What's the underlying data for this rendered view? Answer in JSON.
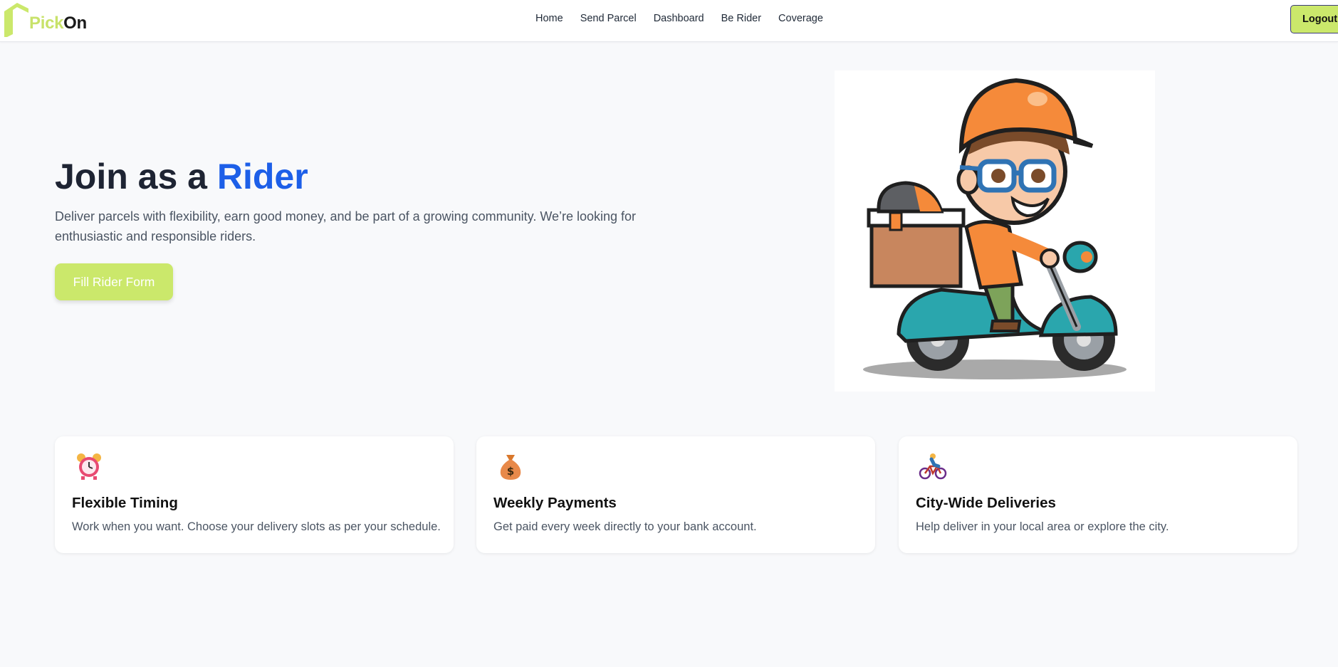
{
  "brand": {
    "part1": "Pick",
    "part2": "On"
  },
  "nav": {
    "links": [
      "Home",
      "Send Parcel",
      "Dashboard",
      "Be Rider",
      "Coverage"
    ],
    "logout_label": "Logout"
  },
  "hero": {
    "title_prefix": "Join as a ",
    "title_accent": "Rider",
    "description": "Deliver parcels with flexibility, earn good money, and be part of a growing community. We’re looking for enthusiastic and responsible riders.",
    "cta_label": "Fill Rider Form",
    "image": "delivery-rider-on-scooter-illustration"
  },
  "features": [
    {
      "icon": "alarm-clock-icon",
      "title": "Flexible Timing",
      "description": "Work when you want. Choose your delivery slots as per your schedule."
    },
    {
      "icon": "money-bag-icon",
      "title": "Weekly Payments",
      "description": "Get paid every week directly to your bank account."
    },
    {
      "icon": "cyclist-icon",
      "title": "City-Wide Deliveries",
      "description": "Help deliver in your local area or explore the city."
    }
  ],
  "colors": {
    "brand_green": "#cbe86b",
    "accent_blue": "#1d5fe8",
    "background": "#f8f9fb"
  }
}
